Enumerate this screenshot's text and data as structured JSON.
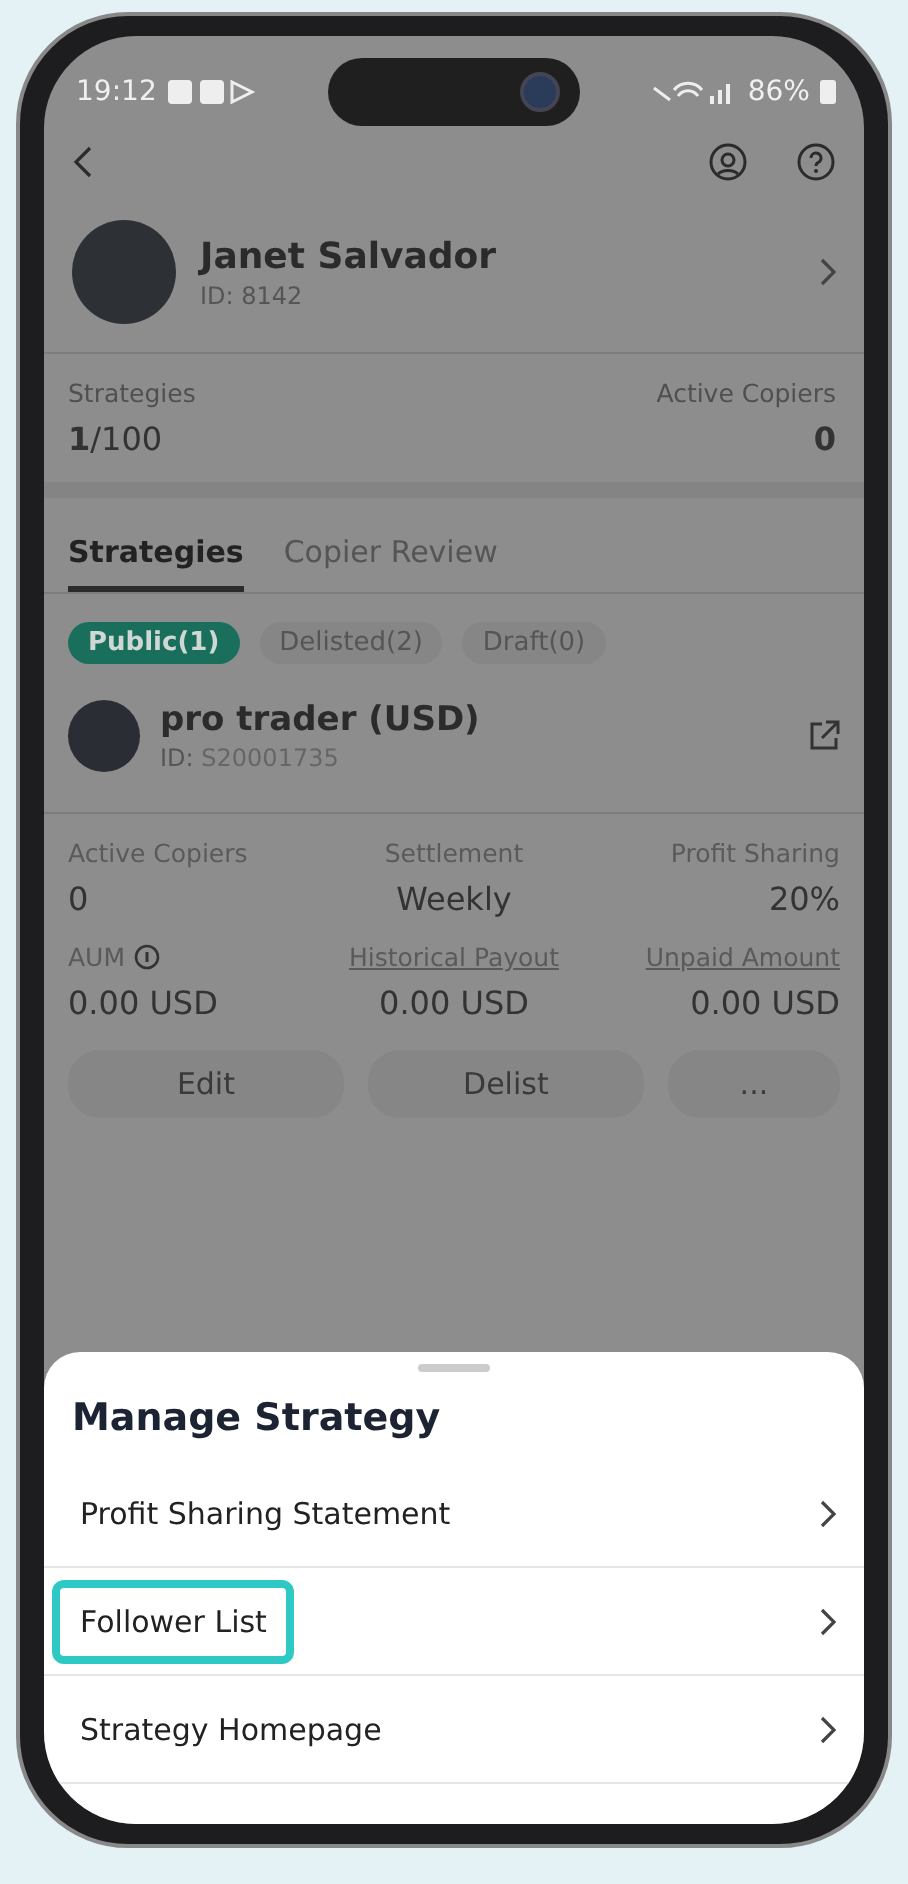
{
  "status_bar": {
    "time": "19:12",
    "battery": "86%"
  },
  "profile": {
    "name": "Janet Salvador",
    "id": "ID: 8142"
  },
  "summary": [
    {
      "label": "Strategies",
      "value_bold": "1",
      "value_rest": "/100"
    },
    {
      "label": "Active Copiers",
      "value_bold": "0"
    }
  ],
  "tabs": [
    {
      "label": "Strategies",
      "selected": true
    },
    {
      "label": "Copier Review",
      "selected": false
    }
  ],
  "filters": [
    {
      "label": "Public(1)",
      "selected": true
    },
    {
      "label": "Delisted(2)",
      "selected": false
    },
    {
      "label": "Draft(0)",
      "selected": false
    }
  ],
  "strategy": {
    "name": "pro trader (USD)",
    "id_label": "ID:",
    "id": "S20001735",
    "metrics": [
      {
        "label": "Active Copiers",
        "value": "0",
        "underlined": false,
        "info": false
      },
      {
        "label": "Settlement",
        "value": "Weekly",
        "underlined": false,
        "info": false
      },
      {
        "label": "Profit Sharing",
        "value": "20%",
        "underlined": false,
        "info": false
      },
      {
        "label": "AUM",
        "value": "0.00 USD",
        "underlined": false,
        "info": true
      },
      {
        "label": "Historical Payout",
        "value": "0.00 USD",
        "underlined": true,
        "info": false
      },
      {
        "label": "Unpaid Amount",
        "value": "0.00 USD",
        "underlined": true,
        "info": false
      }
    ],
    "buttons": [
      "Edit",
      "Delist",
      "..."
    ]
  },
  "sheet": {
    "title": "Manage Strategy",
    "items": [
      {
        "label": "Profit Sharing Statement",
        "highlighted": false
      },
      {
        "label": "Follower List",
        "highlighted": true
      },
      {
        "label": "Strategy Homepage",
        "highlighted": false
      }
    ]
  }
}
